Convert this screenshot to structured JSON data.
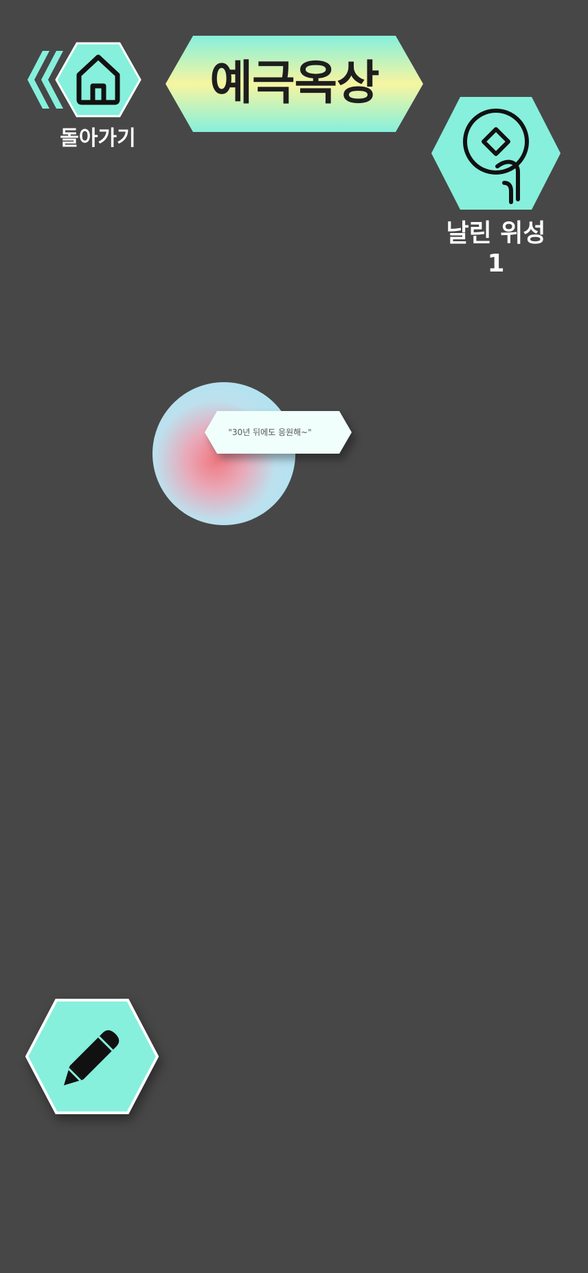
{
  "header": {
    "back_label": "돌아가기",
    "title": "예극옥상"
  },
  "satellite": {
    "label": "날린 위성",
    "count": "1"
  },
  "messages": [
    {
      "text": "\"30년 뒤에도 응원해~\""
    }
  ],
  "icons": {
    "back": "double-chevron-left-icon",
    "home": "home-icon",
    "satellite": "coin-satellite-icon",
    "write": "pencil-icon"
  },
  "colors": {
    "background": "#474747",
    "accent": "#86f0dc",
    "banner_highlight": "#f7f5a0",
    "text_light": "#ffffff",
    "text_dark": "#1e1e1e"
  }
}
